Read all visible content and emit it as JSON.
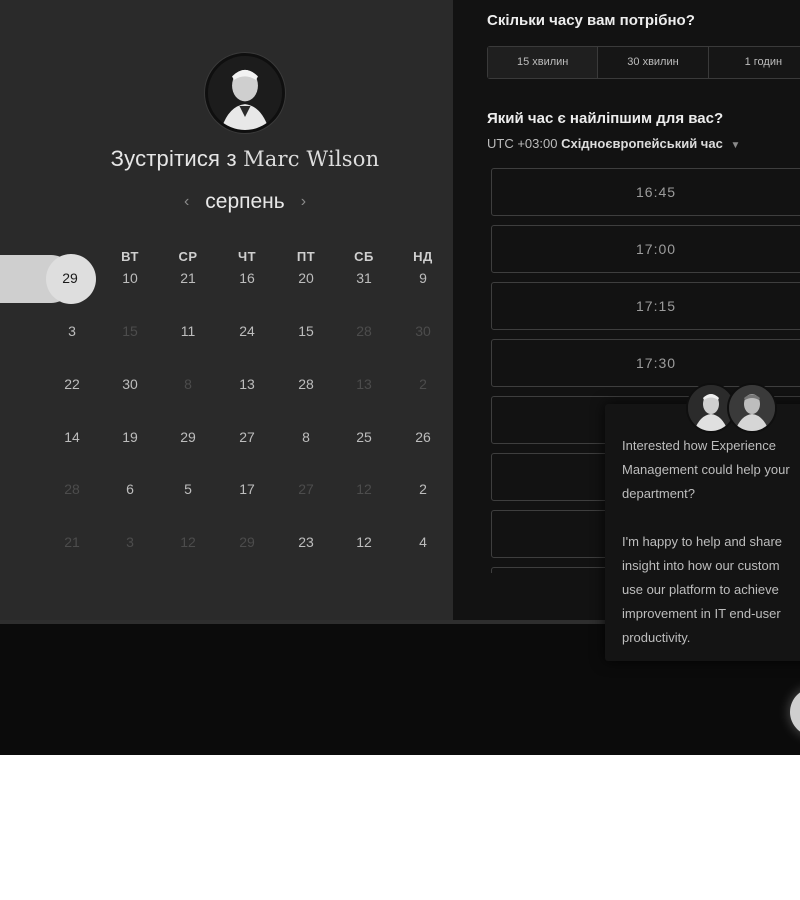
{
  "header": {
    "meet_prefix": "Зустрітися з",
    "host_name": "Marc Wilson",
    "month": "серпень",
    "prev_icon": "chevron-left-icon",
    "next_icon": "chevron-right-icon"
  },
  "calendar": {
    "weekdays": [
      "ВТ",
      "СР",
      "ЧТ",
      "ПТ",
      "СБ",
      "НД"
    ],
    "selected_day": "29",
    "rows": [
      [
        {
          "d": "29",
          "dim": false
        },
        {
          "d": "10",
          "dim": false
        },
        {
          "d": "21",
          "dim": false
        },
        {
          "d": "16",
          "dim": false
        },
        {
          "d": "20",
          "dim": false
        },
        {
          "d": "31",
          "dim": false
        },
        {
          "d": "9",
          "dim": false
        }
      ],
      [
        {
          "d": "3",
          "dim": false
        },
        {
          "d": "15",
          "dim": true
        },
        {
          "d": "11",
          "dim": false
        },
        {
          "d": "24",
          "dim": false
        },
        {
          "d": "15",
          "dim": false
        },
        {
          "d": "28",
          "dim": true
        },
        {
          "d": "30",
          "dim": true
        }
      ],
      [
        {
          "d": "22",
          "dim": false
        },
        {
          "d": "30",
          "dim": false
        },
        {
          "d": "8",
          "dim": true
        },
        {
          "d": "13",
          "dim": false
        },
        {
          "d": "28",
          "dim": false
        },
        {
          "d": "13",
          "dim": true
        },
        {
          "d": "2",
          "dim": true
        }
      ],
      [
        {
          "d": "14",
          "dim": false
        },
        {
          "d": "19",
          "dim": false
        },
        {
          "d": "29",
          "dim": false
        },
        {
          "d": "27",
          "dim": false
        },
        {
          "d": "8",
          "dim": false
        },
        {
          "d": "25",
          "dim": false
        },
        {
          "d": "26",
          "dim": false
        }
      ],
      [
        {
          "d": "28",
          "dim": true
        },
        {
          "d": "6",
          "dim": false
        },
        {
          "d": "5",
          "dim": false
        },
        {
          "d": "17",
          "dim": false
        },
        {
          "d": "27",
          "dim": true
        },
        {
          "d": "12",
          "dim": true
        },
        {
          "d": "2",
          "dim": false
        }
      ],
      [
        {
          "d": "21",
          "dim": true
        },
        {
          "d": "3",
          "dim": true
        },
        {
          "d": "12",
          "dim": true
        },
        {
          "d": "29",
          "dim": true
        },
        {
          "d": "23",
          "dim": false
        },
        {
          "d": "12",
          "dim": false
        },
        {
          "d": "4",
          "dim": false
        }
      ]
    ]
  },
  "scheduler": {
    "duration_question": "Скільки часу вам потрібно?",
    "durations": [
      "15 хвилин",
      "30 хвилин",
      "1 годин"
    ],
    "time_question": "Який час є найліпшим для вас?",
    "timezone_offset": "UTC +03:00",
    "timezone_name": "Східноєвропейський час",
    "slots": [
      "16:45",
      "17:00",
      "17:15",
      "17:30",
      "",
      "",
      "",
      ""
    ]
  },
  "chat": {
    "message": "Interested how Experience\nManagement could help your\ndepartment?\n\nI'm happy to help and share\ninsight into how our custom\nuse our platform to achieve\nimprovement in IT end-user\nproductivity."
  },
  "colors": {
    "left_bg": "#2a2a2a",
    "right_bg": "#121212",
    "selected": "#dedede"
  }
}
